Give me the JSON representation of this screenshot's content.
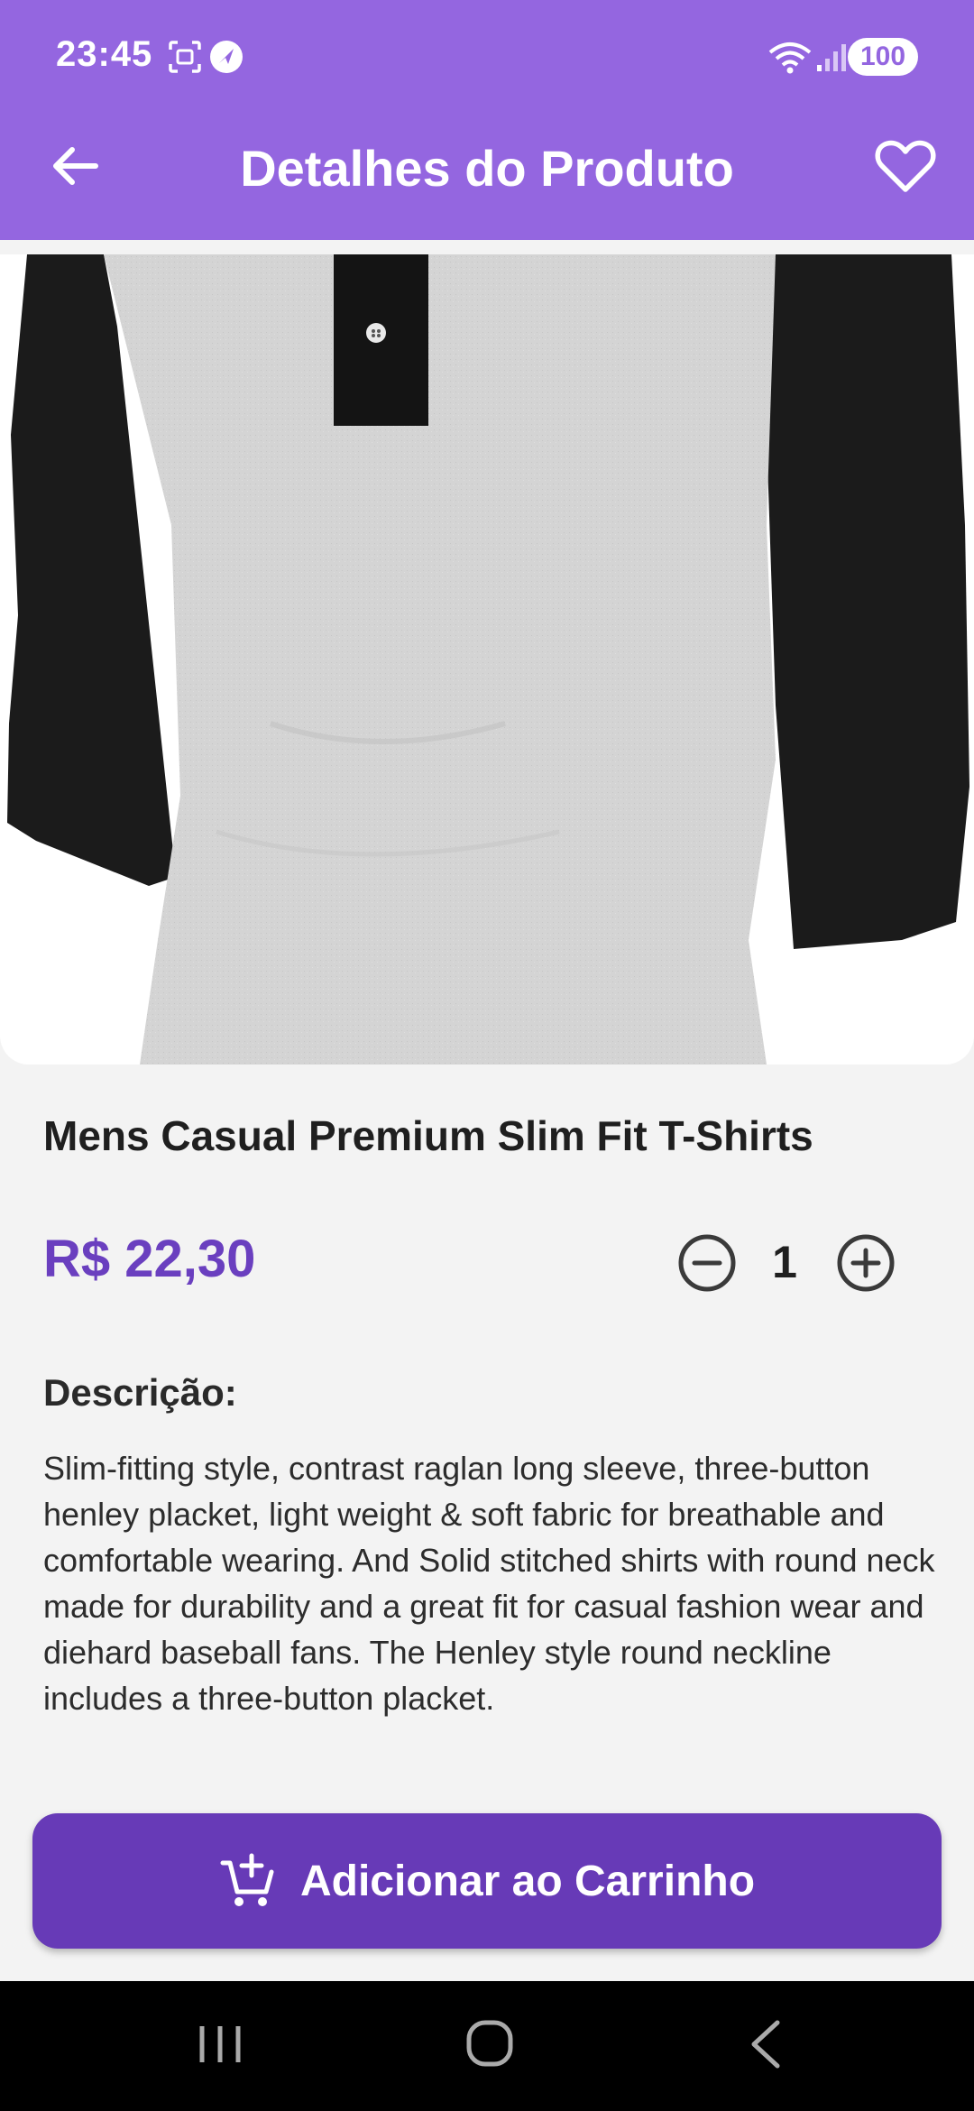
{
  "status_bar": {
    "time": "23:45",
    "battery": "100",
    "icons": [
      "screenshot-icon",
      "location-icon",
      "wifi-icon",
      "signal-icon"
    ]
  },
  "app_bar": {
    "title": "Detalhes do Produto",
    "back_icon": "arrow-back-icon",
    "favorite_icon": "heart-outline-icon"
  },
  "product": {
    "name": "Mens Casual Premium Slim Fit T-Shirts",
    "price": "R$ 22,30",
    "quantity": "1",
    "description_label": "Descrição:",
    "description": "Slim-fitting style, contrast raglan long sleeve, three-button henley placket, light weight & soft fabric for breathable and comfortable wearing. And Solid stitched shirts with round neck made for durability and a great fit for casual fashion wear and diehard baseball fans. The Henley style round neckline includes a three-button placket."
  },
  "actions": {
    "add_to_cart": "Adicionar ao Carrinho"
  },
  "colors": {
    "primary": "#9466e0",
    "button": "#673ab7",
    "price": "#6a3fbf",
    "background": "#f3f3f3"
  },
  "system_nav": {
    "icons": [
      "recents-icon",
      "home-icon",
      "back-icon"
    ]
  }
}
